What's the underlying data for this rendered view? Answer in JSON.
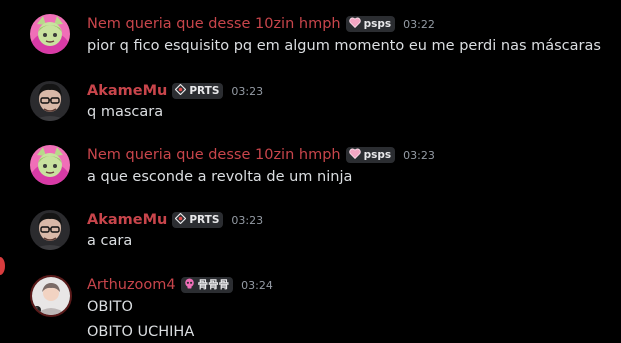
{
  "messages": [
    {
      "username": "Nem queria que desse 10zin hmph",
      "tag_label": "psps",
      "tag_icon": "heart-icon",
      "timestamp": "03:22",
      "lines": [
        "pior q fico esquisito pq em algum momento eu me perdi nas máscaras"
      ]
    },
    {
      "username": "AkameMu",
      "tag_label": "PRTS",
      "tag_icon": "diamond-emblem-icon",
      "timestamp": "03:23",
      "lines": [
        "q mascara"
      ]
    },
    {
      "username": "Nem queria que desse 10zin hmph",
      "tag_label": "psps",
      "tag_icon": "heart-icon",
      "timestamp": "03:23",
      "lines": [
        "a que esconde a revolta de um ninja"
      ]
    },
    {
      "username": "AkameMu",
      "tag_label": "PRTS",
      "tag_icon": "diamond-emblem-icon",
      "timestamp": "03:23",
      "lines": [
        "a cara"
      ]
    },
    {
      "username": "Arthuzoom4",
      "tag_label": "骨骨骨",
      "tag_icon": "skull-icon",
      "timestamp": "03:24",
      "lines": [
        "OBITO",
        "OBITO UCHIHA"
      ]
    }
  ],
  "colors": {
    "background": "#000000",
    "username": "#c8454b",
    "message_text": "#dbdee1",
    "timestamp": "#949ba4",
    "tag_background": "#2b2d31",
    "notification_dot": "#d83c3e"
  }
}
